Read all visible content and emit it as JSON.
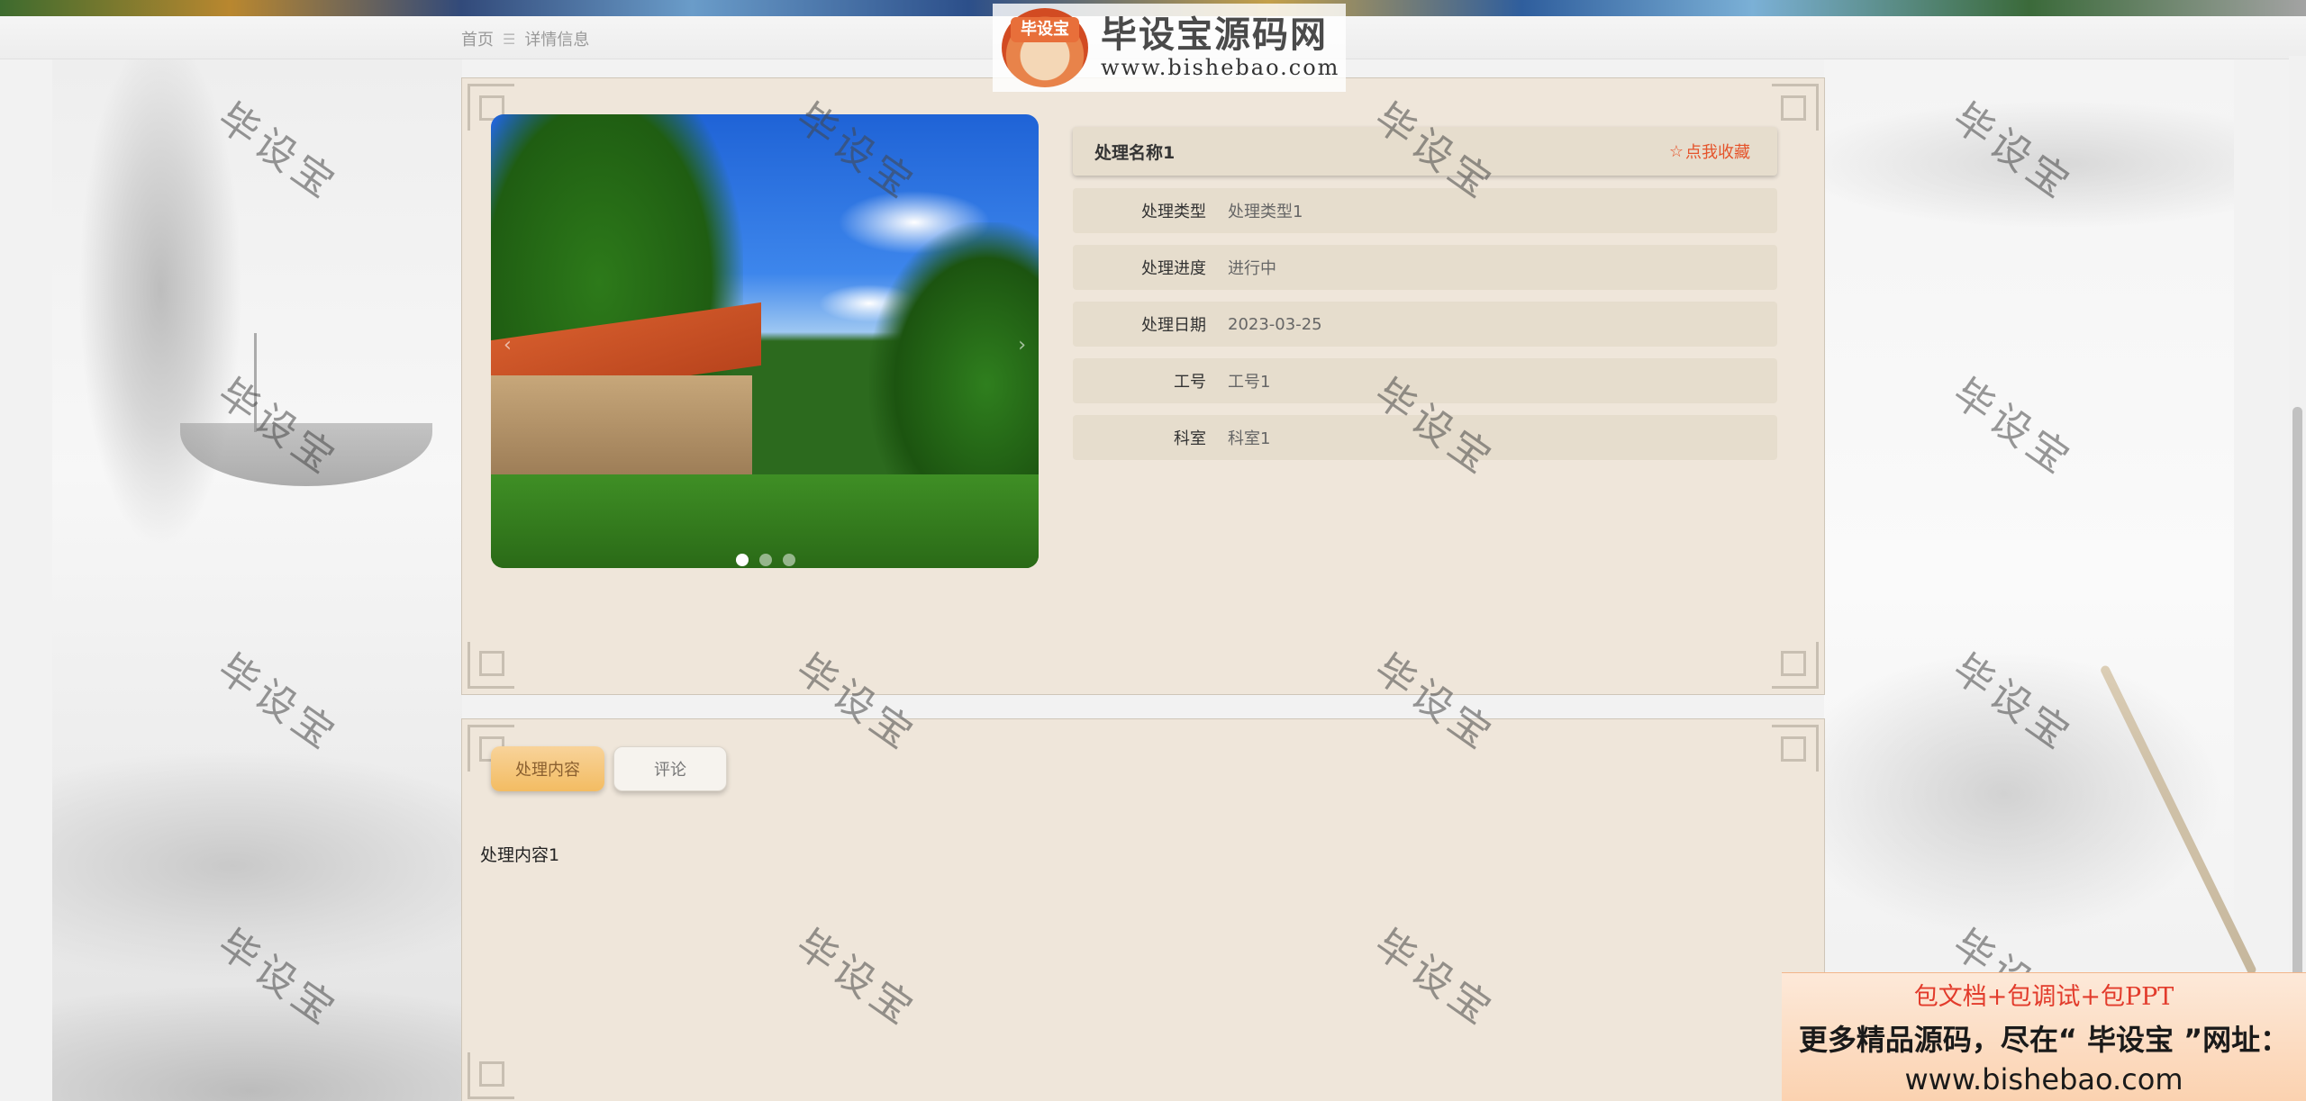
{
  "breadcrumb": {
    "home": "首页",
    "separator": "☰",
    "current": "详情信息"
  },
  "logo": {
    "badge": "毕设宝",
    "title": "毕设宝源码网",
    "url": "www.bishebao.com"
  },
  "detail": {
    "name": "处理名称1",
    "favorite_label": "点我收藏",
    "favorite_icon": "star-outline-icon",
    "fields": [
      {
        "label": "处理类型",
        "value": "处理类型1"
      },
      {
        "label": "处理进度",
        "value": "进行中"
      },
      {
        "label": "处理日期",
        "value": "2023-03-25"
      },
      {
        "label": "工号",
        "value": "工号1"
      },
      {
        "label": "科室",
        "value": "科室1"
      }
    ]
  },
  "carousel": {
    "slide_count": 3,
    "active_index": 0
  },
  "tabs": [
    {
      "label": "处理内容",
      "active": true
    },
    {
      "label": "评论",
      "active": false
    }
  ],
  "content_text": "处理内容1",
  "watermark_text": "毕设宝",
  "ad": {
    "line1": "包文档+包调试+包PPT",
    "line2": "更多精品源码，尽在“ 毕设宝 ”网址：",
    "line3": "www.bishebao.com"
  },
  "colors": {
    "accent": "#e5532a",
    "panel_bg": "#efe6da",
    "tab_active": "#f3bc62"
  }
}
